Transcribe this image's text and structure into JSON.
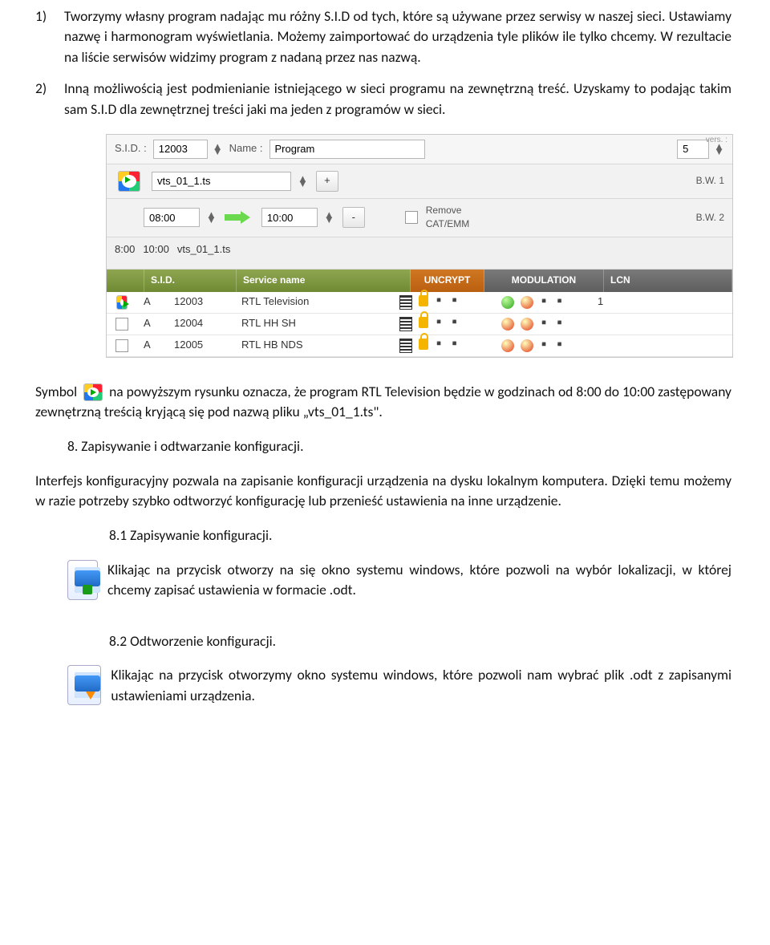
{
  "list": {
    "n1": "1)",
    "body1": "Tworzymy własny program nadając mu różny S.I.D od tych, które są używane przez serwisy w naszej sieci. Ustawiamy nazwę i harmonogram wyświetlania. Możemy zaimportować do urządzenia tyle plików ile tylko chcemy.  W rezultacie na liście serwisów widzimy program z nadaną przez nas nazwą.",
    "n2": "2)",
    "body2": "Inną możliwością jest podmienianie istniejącego w sieci programu na zewnętrzną treść. Uzyskamy to podając takim sam S.I.D dla zewnętrznej treści jaki ma jeden z programów w sieci."
  },
  "ss": {
    "sid_label": "S.I.D. :",
    "sid_value": "12003",
    "name_label": "Name :",
    "name_value": "Program",
    "vers": "vers. :",
    "five": "5",
    "file": "vts_01_1.ts",
    "plus": "+",
    "t1": "08:00",
    "t2": "10:00",
    "minus": "-",
    "remove": "Remove CAT/EMM",
    "bw1": "B.W. 1",
    "bw2": "B.W. 2",
    "schedule_a": "8:00",
    "schedule_b": "10:00",
    "schedule_f": "vts_01_1.ts",
    "th_sid": "S.I.D.",
    "th_name": "Service name",
    "th_unc": "UNCRYPT",
    "th_mod": "MODULATION",
    "th_lcn": "LCN",
    "rows": [
      {
        "a": "A",
        "sid": "12003",
        "name": "RTL Television",
        "g": true,
        "lcn": "1"
      },
      {
        "a": "A",
        "sid": "12004",
        "name": "RTL HH SH",
        "g": false,
        "lcn": ""
      },
      {
        "a": "A",
        "sid": "12005",
        "name": "RTL HB NDS",
        "g": false,
        "lcn": ""
      }
    ]
  },
  "para_symbol_a": "Symbol ",
  "para_symbol_b": " na powyższym rysunku oznacza, że program RTL Television będzie w godzinach od 8:00 do 10:00 zastępowany zewnętrzną treścią kryjącą się pod nazwą pliku „vts_01_1.ts\".",
  "h8": "8.   Zapisywanie i odtwarzanie konfiguracji.",
  "p8": "Interfejs konfiguracyjny pozwala na zapisanie konfiguracji urządzenia na dysku lokalnym komputera. Dzięki temu możemy w razie potrzeby szybko odtworzyć konfigurację lub przenieść ustawienia na inne urządzenie.",
  "h81": "8.1  Zapisywanie konfiguracji.",
  "p81": "Klikając na przycisk otworzy na się okno systemu windows, które pozwoli na wybór lokalizacji, w której chcemy zapisać ustawienia w formacie .odt.",
  "h82": "8.2  Odtworzenie konfiguracji.",
  "p82": "Klikając na przycisk otworzymy okno systemu windows, które pozwoli nam wybrać plik .odt z zapisanymi ustawieniami urządzenia."
}
